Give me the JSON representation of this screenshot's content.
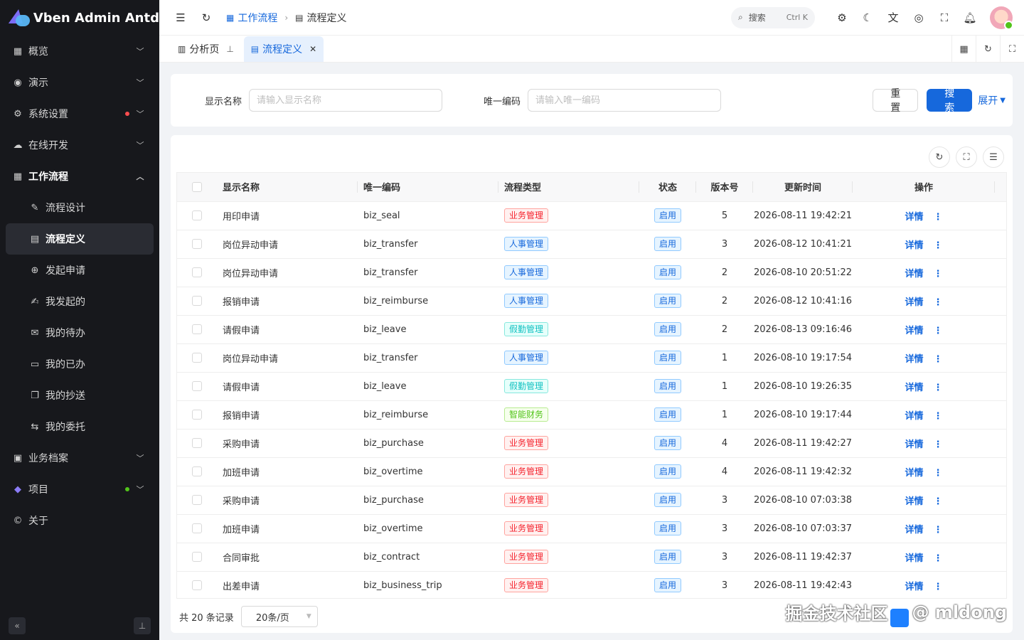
{
  "app": {
    "title": "Vben Admin Antd"
  },
  "sidebar": {
    "items": [
      {
        "label": "概览",
        "icon": "grid-icon",
        "chevron": "down"
      },
      {
        "label": "演示",
        "icon": "demo-icon",
        "chevron": "down"
      },
      {
        "label": "系统设置",
        "icon": "gear-icon",
        "chevron": "down",
        "dot": "#ff4d4f"
      },
      {
        "label": "在线开发",
        "icon": "cloud-icon",
        "chevron": "down"
      },
      {
        "label": "工作流程",
        "icon": "grid-icon",
        "chevron": "up",
        "open": true
      },
      {
        "label": "流程设计",
        "icon": "design-icon",
        "sub": true
      },
      {
        "label": "流程定义",
        "icon": "document-icon",
        "sub": true,
        "active": true
      },
      {
        "label": "发起申请",
        "icon": "plus-circle-icon",
        "sub": true
      },
      {
        "label": "我发起的",
        "icon": "edit-icon",
        "sub": true
      },
      {
        "label": "我的待办",
        "icon": "mail-icon",
        "sub": true
      },
      {
        "label": "我的已办",
        "icon": "list-icon",
        "sub": true
      },
      {
        "label": "我的抄送",
        "icon": "copy-icon",
        "sub": true
      },
      {
        "label": "我的委托",
        "icon": "swap-icon",
        "sub": true
      },
      {
        "label": "业务档案",
        "icon": "archive-icon",
        "chevron": "down"
      },
      {
        "label": "项目",
        "icon": "logo-icon",
        "chevron": "down",
        "dot": "#52c41a"
      },
      {
        "label": "关于",
        "icon": "copyright-icon"
      }
    ]
  },
  "header": {
    "breadcrumb": [
      "工作流程",
      "流程定义"
    ],
    "search_label": "搜索",
    "search_kbd": "Ctrl K"
  },
  "tabs": [
    {
      "label": "分析页",
      "active": false
    },
    {
      "label": "流程定义",
      "active": true
    }
  ],
  "form": {
    "name_label": "显示名称",
    "name_placeholder": "请输入显示名称",
    "code_label": "唯一编码",
    "code_placeholder": "请输入唯一编码",
    "reset_label": "重 置",
    "search_label": "搜 索",
    "expand_label": "展开"
  },
  "table": {
    "columns": [
      "显示名称",
      "唯一编码",
      "流程类型",
      "状态",
      "版本号",
      "更新时间",
      "操作"
    ],
    "detail_label": "详情",
    "status_label": "启用",
    "rows": [
      {
        "name": "用印申请",
        "code": "biz_seal",
        "type": "业务管理",
        "version": "5",
        "updated": "2026-08-11 19:42:21"
      },
      {
        "name": "岗位异动申请",
        "code": "biz_transfer",
        "type": "人事管理",
        "version": "3",
        "updated": "2026-08-12 10:41:21"
      },
      {
        "name": "岗位异动申请",
        "code": "biz_transfer",
        "type": "人事管理",
        "version": "2",
        "updated": "2026-08-10 20:51:22"
      },
      {
        "name": "报销申请",
        "code": "biz_reimburse",
        "type": "人事管理",
        "version": "2",
        "updated": "2026-08-12 10:41:16"
      },
      {
        "name": "请假申请",
        "code": "biz_leave",
        "type": "假勤管理",
        "version": "2",
        "updated": "2026-08-13 09:16:46"
      },
      {
        "name": "岗位异动申请",
        "code": "biz_transfer",
        "type": "人事管理",
        "version": "1",
        "updated": "2026-08-10 19:17:54"
      },
      {
        "name": "请假申请",
        "code": "biz_leave",
        "type": "假勤管理",
        "version": "1",
        "updated": "2026-08-10 19:26:35"
      },
      {
        "name": "报销申请",
        "code": "biz_reimburse",
        "type": "智能财务",
        "version": "1",
        "updated": "2026-08-10 19:17:44"
      },
      {
        "name": "采购申请",
        "code": "biz_purchase",
        "type": "业务管理",
        "version": "4",
        "updated": "2026-08-11 19:42:27"
      },
      {
        "name": "加班申请",
        "code": "biz_overtime",
        "type": "业务管理",
        "version": "4",
        "updated": "2026-08-11 19:42:32"
      },
      {
        "name": "采购申请",
        "code": "biz_purchase",
        "type": "业务管理",
        "version": "3",
        "updated": "2026-08-10 07:03:38"
      },
      {
        "name": "加班申请",
        "code": "biz_overtime",
        "type": "业务管理",
        "version": "3",
        "updated": "2026-08-10 07:03:37"
      },
      {
        "name": "合同审批",
        "code": "biz_contract",
        "type": "业务管理",
        "version": "3",
        "updated": "2026-08-11 19:42:37"
      },
      {
        "name": "出差申请",
        "code": "biz_business_trip",
        "type": "业务管理",
        "version": "3",
        "updated": "2026-08-11 19:42:43"
      }
    ]
  },
  "tag_colors": {
    "业务管理": {
      "fg": "#f5222d",
      "bg": "#fff1f0",
      "bd": "#ffa39e"
    },
    "人事管理": {
      "fg": "#1668dc",
      "bg": "#e6f4ff",
      "bd": "#91caff"
    },
    "假勤管理": {
      "fg": "#13c2c2",
      "bg": "#e6fffb",
      "bd": "#87e8de"
    },
    "智能财务": {
      "fg": "#52c41a",
      "bg": "#f6ffed",
      "bd": "#b7eb8f"
    },
    "status": {
      "fg": "#1668dc",
      "bg": "#e6f4ff",
      "bd": "#91caff"
    }
  },
  "pager": {
    "total_label": "共 20 条记录",
    "page_size": "20条/页"
  },
  "watermark": {
    "text_left": "掘金技术社区",
    "text_right": "@ mldong"
  }
}
